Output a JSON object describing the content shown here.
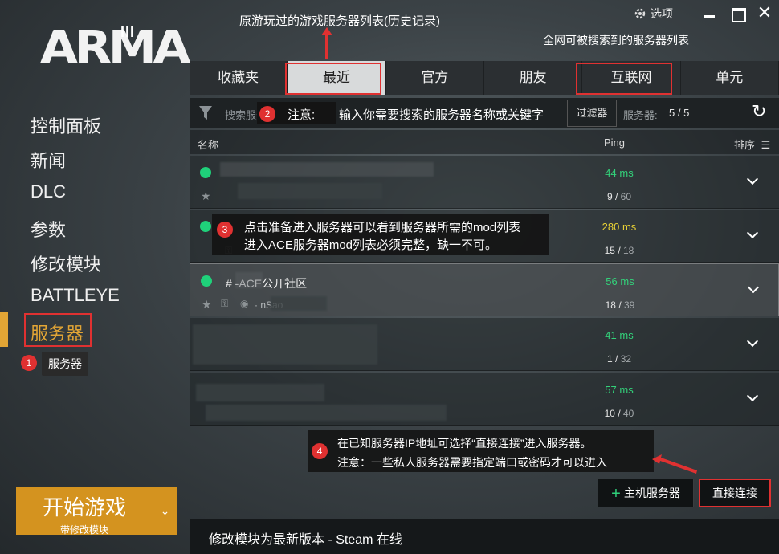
{
  "window": {
    "settings_label": "选项"
  },
  "logo": {
    "text": "ARMA",
    "version": "III"
  },
  "sidebar": {
    "items": [
      {
        "label": "控制面板"
      },
      {
        "label": "新闻"
      },
      {
        "label": "DLC"
      },
      {
        "label": "参数"
      },
      {
        "label": "修改模块"
      },
      {
        "label": "BATTLEYE"
      },
      {
        "label": "服务器"
      }
    ],
    "tooltip": "服务器"
  },
  "play": {
    "title": "开始游戏",
    "subtitle": "带修改模块"
  },
  "tabs": [
    {
      "label": "收藏夹"
    },
    {
      "label": "最近"
    },
    {
      "label": "官方"
    },
    {
      "label": "朋友"
    },
    {
      "label": "互联网"
    },
    {
      "label": "单元"
    }
  ],
  "search": {
    "placeholder": "搜索服务器",
    "filter_label": "过滤器",
    "count_label": "服务器:",
    "count_value": "5 / 5"
  },
  "columns": {
    "name": "名称",
    "ping": "Ping",
    "sort": "排序"
  },
  "servers": [
    {
      "name": "",
      "sub": "",
      "ping": "44 ms",
      "players": "9",
      "max": "60"
    },
    {
      "name": "",
      "sub": "",
      "ping": "280 ms",
      "players": "15",
      "max": "18"
    },
    {
      "name": "#        -ACE公开社区",
      "sub": "·              nSao",
      "ping": "56 ms",
      "players": "18",
      "max": "39"
    },
    {
      "name": "",
      "sub": "",
      "ping": "41 ms",
      "players": "1",
      "max": "32"
    },
    {
      "name": "",
      "sub": "",
      "ping": "57 ms",
      "players": "10",
      "max": "40"
    }
  ],
  "buttons": {
    "host": "主机服务器",
    "direct": "直接连接"
  },
  "status": "修改模块为最新版本 - Steam 在线",
  "annotations": {
    "history": "原游玩过的游戏服务器列表(历史记录)",
    "internet": "全网可被搜索到的服务器列表",
    "n1": "1",
    "n2": "2",
    "n3": "3",
    "n4": "4",
    "search_note_prefix": "注意:",
    "search_note": "输入你需要搜索的服务器名称或关键字",
    "mods_line1": "点击准备进入服务器可以看到服务器所需的mod列表",
    "mods_line2": "进入ACE服务器mod列表必须完整，缺一不可。",
    "direct_line1": "在已知服务器IP地址可选择“直接连接”进入服务器。",
    "direct_line2": "注意：一些私人服务器需要指定端口或密码才可以进入"
  },
  "colors": {
    "accent": "#d4931f",
    "annotation_red": "#e03131",
    "ping_good": "#33d17a",
    "ping_warn": "#e8d135"
  }
}
